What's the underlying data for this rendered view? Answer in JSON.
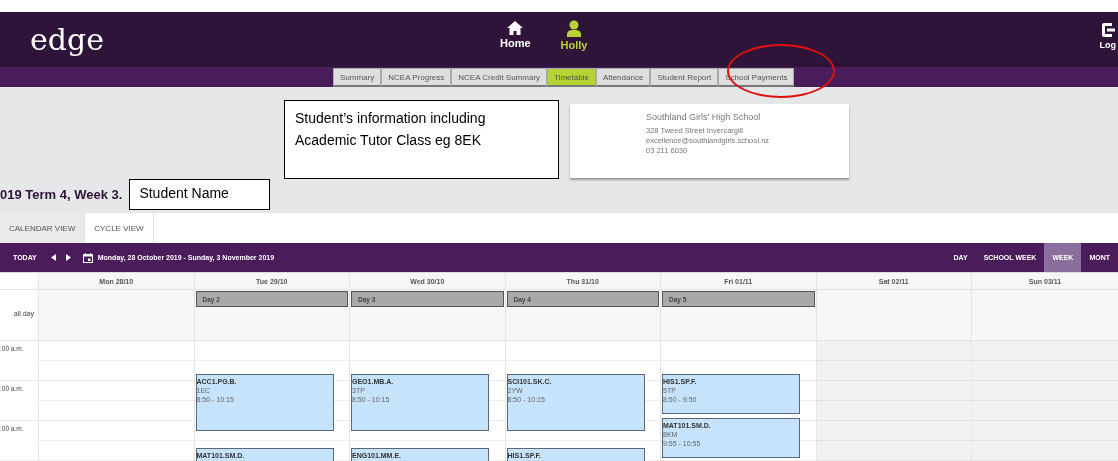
{
  "header": {
    "logo": "edge",
    "nav": [
      {
        "label": "Home",
        "kind": "home",
        "selected": false
      },
      {
        "label": "Holly",
        "kind": "user",
        "selected": true
      }
    ],
    "logout": "Log"
  },
  "tabs": [
    {
      "label": "Summary",
      "selected": false
    },
    {
      "label": "NCEA Progress",
      "selected": false
    },
    {
      "label": "NCEA Credit Summary",
      "selected": false
    },
    {
      "label": "Timetable",
      "selected": true
    },
    {
      "label": "Attendance",
      "selected": false
    },
    {
      "label": "Student Report",
      "selected": false
    },
    {
      "label": "School Payments",
      "selected": false
    }
  ],
  "info_note": "Student’s information including Academic Tutor Class eg 8EK",
  "school": {
    "name": "Southland Girls' High School",
    "address": "328 Tweed Street Invercargill",
    "email": "excellence@southlandgirls.school.nz",
    "phone": "03 211 6030"
  },
  "term_title": "019 Term 4, Week 3.",
  "name_note": "Student Name",
  "view_tabs": [
    {
      "label": "CALENDAR VIEW",
      "selected": true
    },
    {
      "label": "CYCLE VIEW",
      "selected": false
    }
  ],
  "toolbar": {
    "today": "TODAY",
    "date_range": "Monday, 28 October 2019 - Sunday, 3 November 2019",
    "views": [
      {
        "label": "DAY",
        "selected": false
      },
      {
        "label": "SCHOOL WEEK",
        "selected": false
      },
      {
        "label": "WEEK",
        "selected": true
      },
      {
        "label": "MONT",
        "selected": false
      }
    ]
  },
  "calendar": {
    "all_day_label": "all day",
    "time_labels": [
      ":00 a.m.",
      ":00 a.m.",
      ":00 a.m."
    ],
    "days": [
      {
        "header": "Mon 28/10",
        "weekend": false
      },
      {
        "header": "Tue 29/10",
        "weekend": false,
        "day_label": "Day 2",
        "events": [
          {
            "title": "ACC1.PG.B.",
            "room": "1EC",
            "time": "8:50 - 10:15"
          },
          {
            "title": "MAT101.SM.D."
          }
        ]
      },
      {
        "header": "Wed 30/10",
        "weekend": false,
        "day_label": "Day 3",
        "events": [
          {
            "title": "GEO1.MB.A.",
            "room": "3TP",
            "time": "8:50 - 10:15"
          },
          {
            "title": "ENG101.MM.E."
          }
        ]
      },
      {
        "header": "Thu 31/10",
        "weekend": false,
        "day_label": "Day 4",
        "events": [
          {
            "title": "SCI101.SK.C.",
            "room": "2YW",
            "time": "8:50 - 10:15"
          },
          {
            "title": "HIS1.SP.F."
          }
        ]
      },
      {
        "header": "Fri 01/11",
        "weekend": false,
        "day_label": "Day 5",
        "events": [
          {
            "title": "HIS1.SP.F.",
            "room": "5TP",
            "time": "8:50 - 9:50"
          },
          {
            "title": "MAT101.SM.D.",
            "room": "8KM",
            "time": "9:55 - 10:55"
          }
        ]
      },
      {
        "header": "Sat 02/11",
        "weekend": true
      },
      {
        "header": "Sun 03/11",
        "weekend": true
      }
    ]
  }
}
